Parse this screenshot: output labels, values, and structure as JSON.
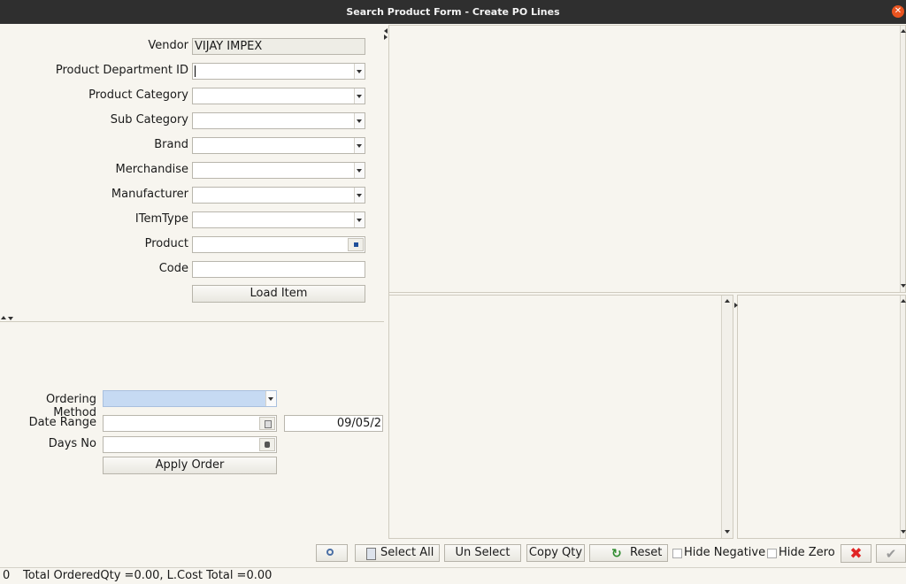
{
  "window": {
    "title": "Search Product Form - Create PO Lines"
  },
  "form": {
    "vendor_label": "Vendor",
    "vendor_value": "VIJAY IMPEX",
    "dept_label": "Product Department ID",
    "category_label": "Product Category",
    "subcategory_label": "Sub Category",
    "brand_label": "Brand",
    "merch_label": "Merchandise",
    "manufacturer_label": "Manufacturer",
    "itemtype_label": "ITemType",
    "product_label": "Product",
    "code_label": "Code",
    "load_item_label": "Load Item"
  },
  "ordering": {
    "method_label": "Ordering Method",
    "date_range_label": "Date Range",
    "date_to_value": "09/05/2",
    "days_no_label": "Days No",
    "apply_label": "Apply Order"
  },
  "toolbar": {
    "select_all_label": "Select All",
    "unselect_label": "Un Select",
    "copy_qty_label": "Copy Qty",
    "reset_label": "Reset",
    "hide_negative_label": "Hide Negative",
    "hide_zero_label": "Hide Zero"
  },
  "status": {
    "count": "0",
    "totals_text": "Total OrderedQty =0.00, L.Cost Total =0.00"
  },
  "colors": {
    "ordering_method_bg": "#c6daf3",
    "close_red": "#e02424",
    "confirm_gray": "#9a9a9a"
  }
}
